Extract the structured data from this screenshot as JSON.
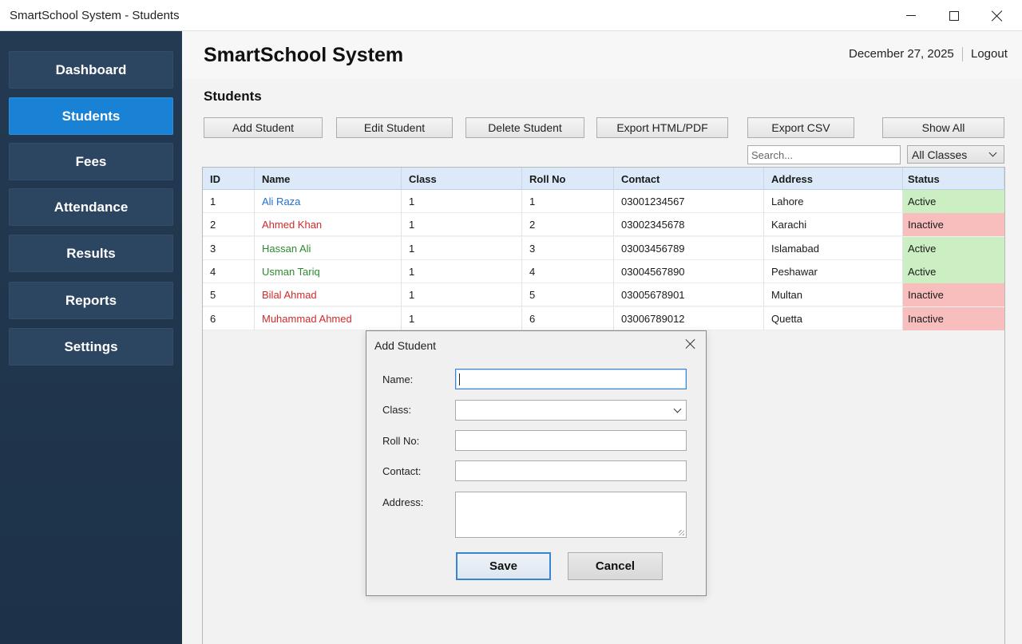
{
  "window": {
    "title": "SmartSchool System - Students"
  },
  "sidebar": {
    "items": [
      {
        "label": "Dashboard",
        "active": false
      },
      {
        "label": "Students",
        "active": true
      },
      {
        "label": "Fees",
        "active": false
      },
      {
        "label": "Attendance",
        "active": false
      },
      {
        "label": "Results",
        "active": false
      },
      {
        "label": "Reports",
        "active": false
      },
      {
        "label": "Settings",
        "active": false
      }
    ]
  },
  "header": {
    "app_title": "SmartSchool System",
    "date": "December 27, 2025",
    "logout_label": "Logout"
  },
  "page": {
    "section_title": "Students"
  },
  "toolbar": {
    "add_label": "Add Student",
    "edit_label": "Edit Student",
    "delete_label": "Delete Student",
    "export_html_label": "Export HTML/PDF",
    "export_csv_label": "Export CSV",
    "show_all_label": "Show All"
  },
  "search": {
    "placeholder": "Search..."
  },
  "filter": {
    "selected": "All Classes"
  },
  "table": {
    "columns": [
      "ID",
      "Name",
      "Class",
      "Roll No",
      "Contact",
      "Address",
      "Status"
    ],
    "rows": [
      {
        "id": "1",
        "name": "Ali Raza",
        "class": "1",
        "roll": "1",
        "contact": "03001234567",
        "address": "Lahore",
        "status": "Active"
      },
      {
        "id": "2",
        "name": "Ahmed Khan",
        "class": "1",
        "roll": "2",
        "contact": "03002345678",
        "address": "Karachi",
        "status": "Inactive"
      },
      {
        "id": "3",
        "name": "Hassan Ali",
        "class": "1",
        "roll": "3",
        "contact": "03003456789",
        "address": "Islamabad",
        "status": "Active"
      },
      {
        "id": "4",
        "name": "Usman Tariq",
        "class": "1",
        "roll": "4",
        "contact": "03004567890",
        "address": "Peshawar",
        "status": "Active"
      },
      {
        "id": "5",
        "name": "Bilal Ahmad",
        "class": "1",
        "roll": "5",
        "contact": "03005678901",
        "address": "Multan",
        "status": "Inactive"
      },
      {
        "id": "6",
        "name": "Muhammad Ahmed",
        "class": "1",
        "roll": "6",
        "contact": "03006789012",
        "address": "Quetta",
        "status": "Inactive"
      }
    ],
    "name_colors": [
      "#1f6fd1",
      "#d22a2a",
      "#2e8a2e",
      "#2e8a2e",
      "#d22a2a",
      "#d22a2a"
    ],
    "status_colors": {
      "Active": "#cbeec2",
      "Inactive": "#f8bdbd"
    }
  },
  "dialog": {
    "title": "Add Student",
    "name_label": "Name:",
    "class_label": "Class:",
    "roll_label": "Roll No:",
    "contact_label": "Contact:",
    "address_label": "Address:",
    "save_label": "Save",
    "cancel_label": "Cancel"
  },
  "colors": {
    "sidebar_bg": "#233a52",
    "nav_item_bg": "#2c4560",
    "accent": "#1a82d4",
    "header_row_bg": "#dce9f8",
    "focus_border": "#3a84d6"
  }
}
